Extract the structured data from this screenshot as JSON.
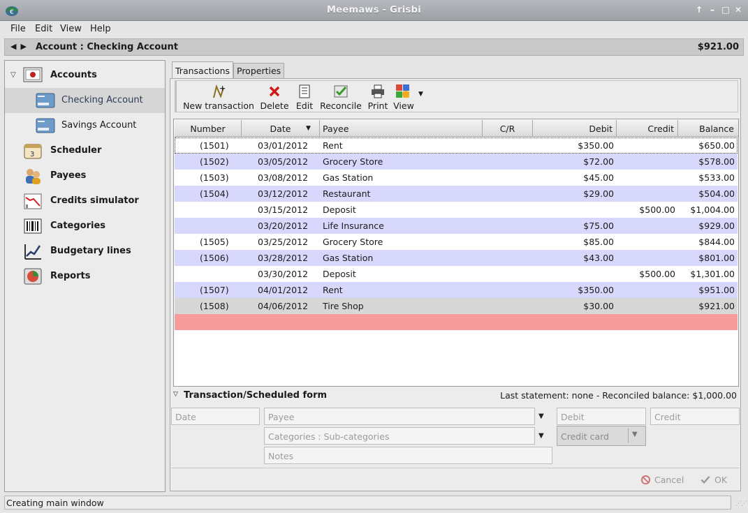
{
  "window": {
    "title": "Meemaws - Grisbi"
  },
  "menu": [
    "File",
    "Edit",
    "View",
    "Help"
  ],
  "account_header": {
    "title": "Account : Checking Account",
    "balance": "$921.00"
  },
  "sidebar": {
    "items": [
      {
        "label": "Accounts",
        "icon": "accounts-icon",
        "level": "top"
      },
      {
        "label": "Checking Account",
        "icon": "bank-card-icon",
        "level": "sub",
        "selected": true
      },
      {
        "label": "Savings Account",
        "icon": "bank-card-icon",
        "level": "sub"
      },
      {
        "label": "Scheduler",
        "icon": "calendar-icon",
        "level": "top"
      },
      {
        "label": "Payees",
        "icon": "people-icon",
        "level": "top"
      },
      {
        "label": "Credits simulator",
        "icon": "chart-down-icon",
        "level": "top"
      },
      {
        "label": "Categories",
        "icon": "barcode-icon",
        "level": "top"
      },
      {
        "label": "Budgetary lines",
        "icon": "chart-up-icon",
        "level": "top"
      },
      {
        "label": "Reports",
        "icon": "pie-chart-icon",
        "level": "top"
      }
    ]
  },
  "tabs": [
    "Transactions",
    "Properties"
  ],
  "toolbar": {
    "new_transaction": "New transaction",
    "delete": "Delete",
    "edit": "Edit",
    "reconcile": "Reconcile",
    "print": "Print",
    "view": "View"
  },
  "table": {
    "headers": [
      "Number",
      "Date",
      "Payee",
      "C/R",
      "Debit",
      "Credit",
      "Balance"
    ],
    "rows": [
      {
        "number": "(1501)",
        "date": "03/01/2012",
        "payee": "Rent",
        "cr": "",
        "debit": "$350.00",
        "credit": "",
        "balance": "$650.00"
      },
      {
        "number": "(1502)",
        "date": "03/05/2012",
        "payee": "Grocery Store",
        "cr": "",
        "debit": "$72.00",
        "credit": "",
        "balance": "$578.00"
      },
      {
        "number": "(1503)",
        "date": "03/08/2012",
        "payee": "Gas Station",
        "cr": "",
        "debit": "$45.00",
        "credit": "",
        "balance": "$533.00"
      },
      {
        "number": "(1504)",
        "date": "03/12/2012",
        "payee": "Restaurant",
        "cr": "",
        "debit": "$29.00",
        "credit": "",
        "balance": "$504.00"
      },
      {
        "number": "",
        "date": "03/15/2012",
        "payee": "Deposit",
        "cr": "",
        "debit": "",
        "credit": "$500.00",
        "balance": "$1,004.00"
      },
      {
        "number": "",
        "date": "03/20/2012",
        "payee": "Life Insurance",
        "cr": "",
        "debit": "$75.00",
        "credit": "",
        "balance": "$929.00"
      },
      {
        "number": "(1505)",
        "date": "03/25/2012",
        "payee": "Grocery Store",
        "cr": "",
        "debit": "$85.00",
        "credit": "",
        "balance": "$844.00"
      },
      {
        "number": "(1506)",
        "date": "03/28/2012",
        "payee": "Gas Station",
        "cr": "",
        "debit": "$43.00",
        "credit": "",
        "balance": "$801.00"
      },
      {
        "number": "",
        "date": "03/30/2012",
        "payee": "Deposit",
        "cr": "",
        "debit": "",
        "credit": "$500.00",
        "balance": "$1,301.00"
      },
      {
        "number": "(1507)",
        "date": "04/01/2012",
        "payee": "Rent",
        "cr": "",
        "debit": "$350.00",
        "credit": "",
        "balance": "$951.00"
      },
      {
        "number": "(1508)",
        "date": "04/06/2012",
        "payee": "Tire Shop",
        "cr": "",
        "debit": "$30.00",
        "credit": "",
        "balance": "$921.00"
      }
    ]
  },
  "form": {
    "header": "Transaction/Scheduled form",
    "last_statement": "Last statement: none - Reconciled balance: $1,000.00",
    "date_placeholder": "Date",
    "payee_placeholder": "Payee",
    "debit_placeholder": "Debit",
    "credit_placeholder": "Credit",
    "category_placeholder": "Categories : Sub-categories",
    "payment_method": "Credit card",
    "notes_placeholder": "Notes",
    "cancel": "Cancel",
    "ok": "OK"
  },
  "status": "Creating main window",
  "colors": {
    "row_alt": "#d8d8fd",
    "new_row": "#f79c9c",
    "selected_row": "#d7d7d7"
  }
}
